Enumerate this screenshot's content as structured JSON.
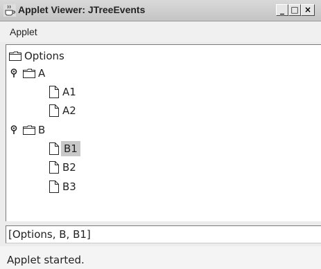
{
  "window": {
    "title": "Applet Viewer: JTreeEvents",
    "minimize_label": "_",
    "maximize_label": "□",
    "close_label": "×"
  },
  "menubar": {
    "items": [
      {
        "label": "Applet"
      }
    ]
  },
  "tree": {
    "root": {
      "label": "Options",
      "icon": "folder-icon"
    },
    "nodes": [
      {
        "label": "A",
        "icon": "folder-icon",
        "handle": "expanded-handle-icon"
      },
      {
        "label": "A1",
        "icon": "leaf-icon"
      },
      {
        "label": "A2",
        "icon": "leaf-icon"
      },
      {
        "label": "B",
        "icon": "folder-icon",
        "handle": "expanded-handle-icon"
      },
      {
        "label": "B1",
        "icon": "leaf-icon",
        "selected": true
      },
      {
        "label": "B2",
        "icon": "leaf-icon"
      },
      {
        "label": "B3",
        "icon": "leaf-icon"
      }
    ]
  },
  "selection_field": {
    "value": "[Options, B, B1]"
  },
  "status": {
    "text": "Applet started."
  },
  "colors": {
    "selection": "#c8c8c8",
    "tree_background": "#ffffff"
  }
}
